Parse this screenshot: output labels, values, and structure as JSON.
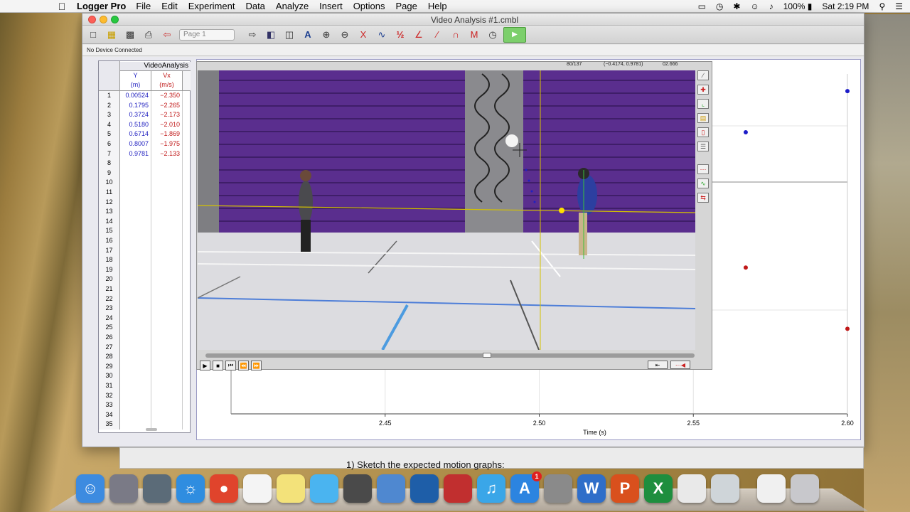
{
  "menubar": {
    "app_name": "Logger Pro",
    "items": [
      "File",
      "Edit",
      "Experiment",
      "Data",
      "Analyze",
      "Insert",
      "Options",
      "Page",
      "Help"
    ],
    "battery": "100%",
    "clock": "Sat 2:19 PM"
  },
  "window": {
    "title": "Video Analysis #1.cmbl",
    "page_select": "Page 1",
    "device_status": "No Device Connected"
  },
  "table": {
    "dataset_title": "VideoAnalysis",
    "columns": [
      {
        "name": "Y",
        "unit": "(m)"
      },
      {
        "name": "Vx",
        "unit": "(m/s)"
      }
    ],
    "rows": [
      {
        "n": "1",
        "y": "0.00524",
        "vx": "−2.350"
      },
      {
        "n": "2",
        "y": "0.1795",
        "vx": "−2.265"
      },
      {
        "n": "3",
        "y": "0.3724",
        "vx": "−2.173"
      },
      {
        "n": "4",
        "y": "0.5180",
        "vx": "−2.010"
      },
      {
        "n": "5",
        "y": "0.6714",
        "vx": "−1.869"
      },
      {
        "n": "6",
        "y": "0.8007",
        "vx": "−1.975"
      },
      {
        "n": "7",
        "y": "0.9781",
        "vx": "−2.133"
      },
      {
        "n": "8",
        "y": "",
        "vx": ""
      },
      {
        "n": "9",
        "y": "",
        "vx": ""
      },
      {
        "n": "10",
        "y": "",
        "vx": ""
      },
      {
        "n": "11",
        "y": "",
        "vx": ""
      },
      {
        "n": "12",
        "y": "",
        "vx": ""
      },
      {
        "n": "13",
        "y": "",
        "vx": ""
      },
      {
        "n": "14",
        "y": "",
        "vx": ""
      },
      {
        "n": "15",
        "y": "",
        "vx": ""
      },
      {
        "n": "16",
        "y": "",
        "vx": ""
      },
      {
        "n": "17",
        "y": "",
        "vx": ""
      },
      {
        "n": "18",
        "y": "",
        "vx": ""
      },
      {
        "n": "19",
        "y": "",
        "vx": ""
      },
      {
        "n": "20",
        "y": "",
        "vx": ""
      },
      {
        "n": "21",
        "y": "",
        "vx": ""
      },
      {
        "n": "22",
        "y": "",
        "vx": ""
      },
      {
        "n": "23",
        "y": "",
        "vx": ""
      },
      {
        "n": "24",
        "y": "",
        "vx": ""
      },
      {
        "n": "25",
        "y": "",
        "vx": ""
      },
      {
        "n": "26",
        "y": "",
        "vx": ""
      },
      {
        "n": "27",
        "y": "",
        "vx": ""
      },
      {
        "n": "28",
        "y": "",
        "vx": ""
      },
      {
        "n": "29",
        "y": "",
        "vx": ""
      },
      {
        "n": "30",
        "y": "",
        "vx": ""
      },
      {
        "n": "31",
        "y": "",
        "vx": ""
      },
      {
        "n": "32",
        "y": "",
        "vx": ""
      },
      {
        "n": "33",
        "y": "",
        "vx": ""
      },
      {
        "n": "34",
        "y": "",
        "vx": ""
      },
      {
        "n": "35",
        "y": "",
        "vx": ""
      }
    ]
  },
  "video": {
    "frame_counter": "80/137",
    "coordinates": "(−0.4174, 0.9781)",
    "time_readout": "02.666"
  },
  "chart_data": {
    "type": "scatter",
    "xlabel": "Time (s)",
    "x_ticks": [
      "2.45",
      "2.50",
      "2.55",
      "2.60"
    ],
    "xlim": [
      2.4,
      2.6
    ],
    "series": [
      {
        "color": "#1c1cc8",
        "points": [
          [
            2.567,
            0.6714
          ],
          [
            2.6,
            0.9781
          ]
        ]
      },
      {
        "color": "#c01818",
        "points": [
          [
            2.567,
            -1.869
          ],
          [
            2.6,
            -2.133
          ]
        ]
      }
    ]
  },
  "document": {
    "visible_text": "1) Sketch the expected motion graphs:"
  },
  "dock": {
    "icons": [
      "finder",
      "launchpad",
      "system-utility",
      "safari",
      "chrome",
      "reminders",
      "stickies",
      "messages",
      "facetime",
      "preview",
      "quicktime",
      "photo-booth",
      "itunes",
      "app-store",
      "system-preferences",
      "word",
      "powerpoint",
      "excel",
      "text-edit",
      "grapher",
      "documents",
      "trash"
    ],
    "app_store_badge": "1"
  },
  "colors": {
    "gym_wall": "#5a2e8e",
    "axis_line": "#d4c200",
    "blue_series": "#1c1cc8",
    "red_series": "#c01818"
  }
}
